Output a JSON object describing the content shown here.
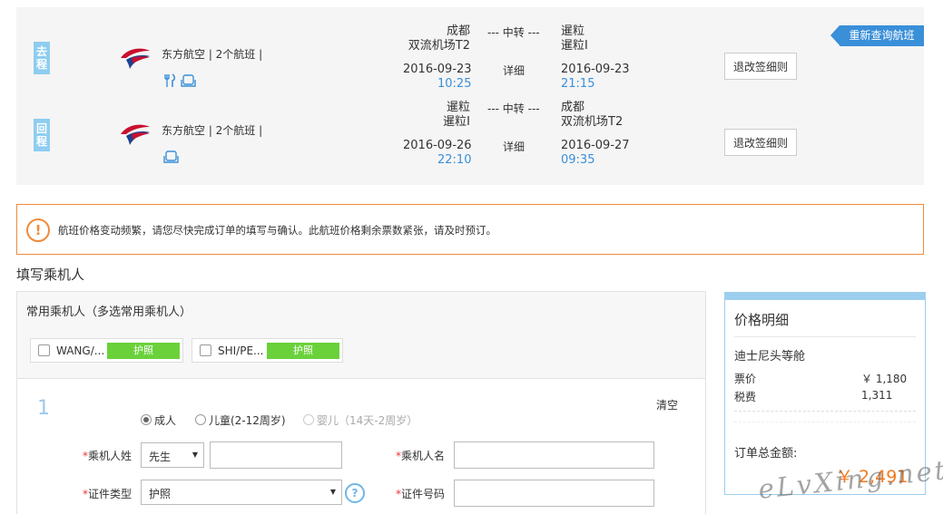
{
  "flights": {
    "requery_label": "重新查询航班",
    "legs": [
      {
        "tag": "去程",
        "airline": "东方航空 | 2个航班 |",
        "from_city": "成都",
        "from_airport": "双流机场T2",
        "to_city": "暹粒",
        "to_airport": "暹粒I",
        "transfer": "--- 中转 ---",
        "dep_date": "2016-09-23",
        "dep_time": "10:25",
        "detail": "详细",
        "arr_date": "2016-09-23",
        "arr_time": "21:15",
        "rules_label": "退改签细则",
        "icons": [
          "meal-icon",
          "seat-icon"
        ]
      },
      {
        "tag": "回程",
        "airline": "东方航空 | 2个航班 |",
        "from_city": "暹粒",
        "from_airport": "暹粒I",
        "to_city": "成都",
        "to_airport": "双流机场T2",
        "transfer": "--- 中转 ---",
        "dep_date": "2016-09-26",
        "dep_time": "22:10",
        "detail": "详细",
        "arr_date": "2016-09-27",
        "arr_time": "09:35",
        "rules_label": "退改签细则",
        "icons": [
          "seat-icon"
        ]
      }
    ]
  },
  "warning": {
    "icon": "!",
    "text": "航班价格变动频繁，请您尽快完成订单的填写与确认。此航班价格剩余票数紧张，请及时预订。"
  },
  "section_title": "填写乘机人",
  "passengers": {
    "header": "常用乘机人（多选常用乘机人）",
    "chips": [
      {
        "name": "WANG/...",
        "doc": "护照"
      },
      {
        "name": "SHI/PE...",
        "doc": "护照"
      }
    ],
    "form": {
      "number": "1",
      "clear_label": "清空",
      "types": [
        {
          "label": "成人",
          "checked": true,
          "disabled": false
        },
        {
          "label": "儿童(2-12周岁)",
          "checked": false,
          "disabled": false
        },
        {
          "label": "婴儿（14天-2周岁）",
          "checked": false,
          "disabled": true
        }
      ],
      "name_label": "乘机人姓",
      "title_value": "先生",
      "name2_label": "乘机人名",
      "id_type_label": "证件类型",
      "id_type_value": "护照",
      "id_no_label": "证件号码",
      "help": "?",
      "required_mark": "*"
    }
  },
  "price": {
    "title": "价格明细",
    "cabin": "迪士尼头等舱",
    "rows": [
      {
        "label": "票价",
        "value": "￥ 1,180"
      },
      {
        "label": "税费",
        "value": "1,311"
      }
    ],
    "total_label": "订单总金额:",
    "total_value": "￥ 2,491"
  },
  "watermark": "eLvXing.net",
  "colors": {
    "accent": "#3a8fd9",
    "warning": "#f08a3a",
    "doc_tag": "#6ad13b",
    "total": "#f47a1f"
  }
}
